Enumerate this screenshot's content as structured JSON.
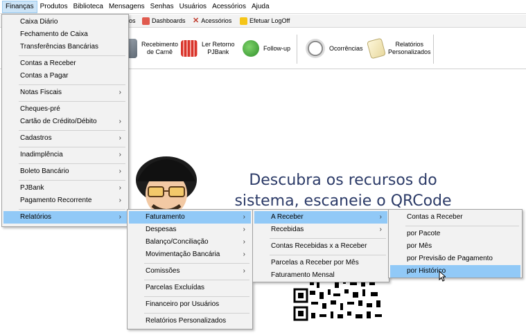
{
  "menubar": {
    "items": [
      "Finanças",
      "Produtos",
      "Biblioteca",
      "Mensagens",
      "Senhas",
      "Usuários",
      "Acessórios",
      "Ajuda"
    ]
  },
  "tabrow": {
    "partial_label": "os",
    "items": [
      "Dashboards",
      "Acessórios",
      "Efetuar LogOff"
    ]
  },
  "toolbar": {
    "items": [
      "Recebimento\nde Carnê",
      "Ler Retorno\nPJBank",
      "Follow-up",
      "Ocorrências",
      "Relatórios\nPersonalizados"
    ]
  },
  "hero": {
    "line1": "Descubra os recursos do",
    "line2": "sistema, escaneie o QRCode"
  },
  "menu_financas": {
    "items": [
      "Caixa Diário",
      "Fechamento de Caixa",
      "Transferências Bancárias",
      "Contas a Receber",
      "Contas a Pagar",
      "Notas Fiscais",
      "Cheques-pré",
      "Cartão de Crédito/Débito",
      "Cadastros",
      "Inadimplência",
      "Boleto Bancário",
      "PJBank",
      "Pagamento Recorrente",
      "Relatórios"
    ]
  },
  "menu_relatorios": {
    "items": [
      "Faturamento",
      "Despesas",
      "Balanço/Conciliação",
      "Movimentação Bancária",
      "Comissões",
      "Parcelas Excluídas",
      "Financeiro por Usuários",
      "Relatórios Personalizados"
    ]
  },
  "menu_faturamento": {
    "items": [
      "A Receber",
      "Recebidas",
      "Contas Recebidas x a Receber",
      "Parcelas a Receber por Mês",
      "Faturamento Mensal"
    ]
  },
  "menu_areceber": {
    "items": [
      "Contas a Receber",
      "por Pacote",
      "por Mês",
      "por Previsão de Pagamento",
      "por Histórico"
    ]
  },
  "colors": {
    "highlight": "#91c9f7",
    "menubar_active": "#cce4f7",
    "hero_text": "#2b3a67"
  }
}
